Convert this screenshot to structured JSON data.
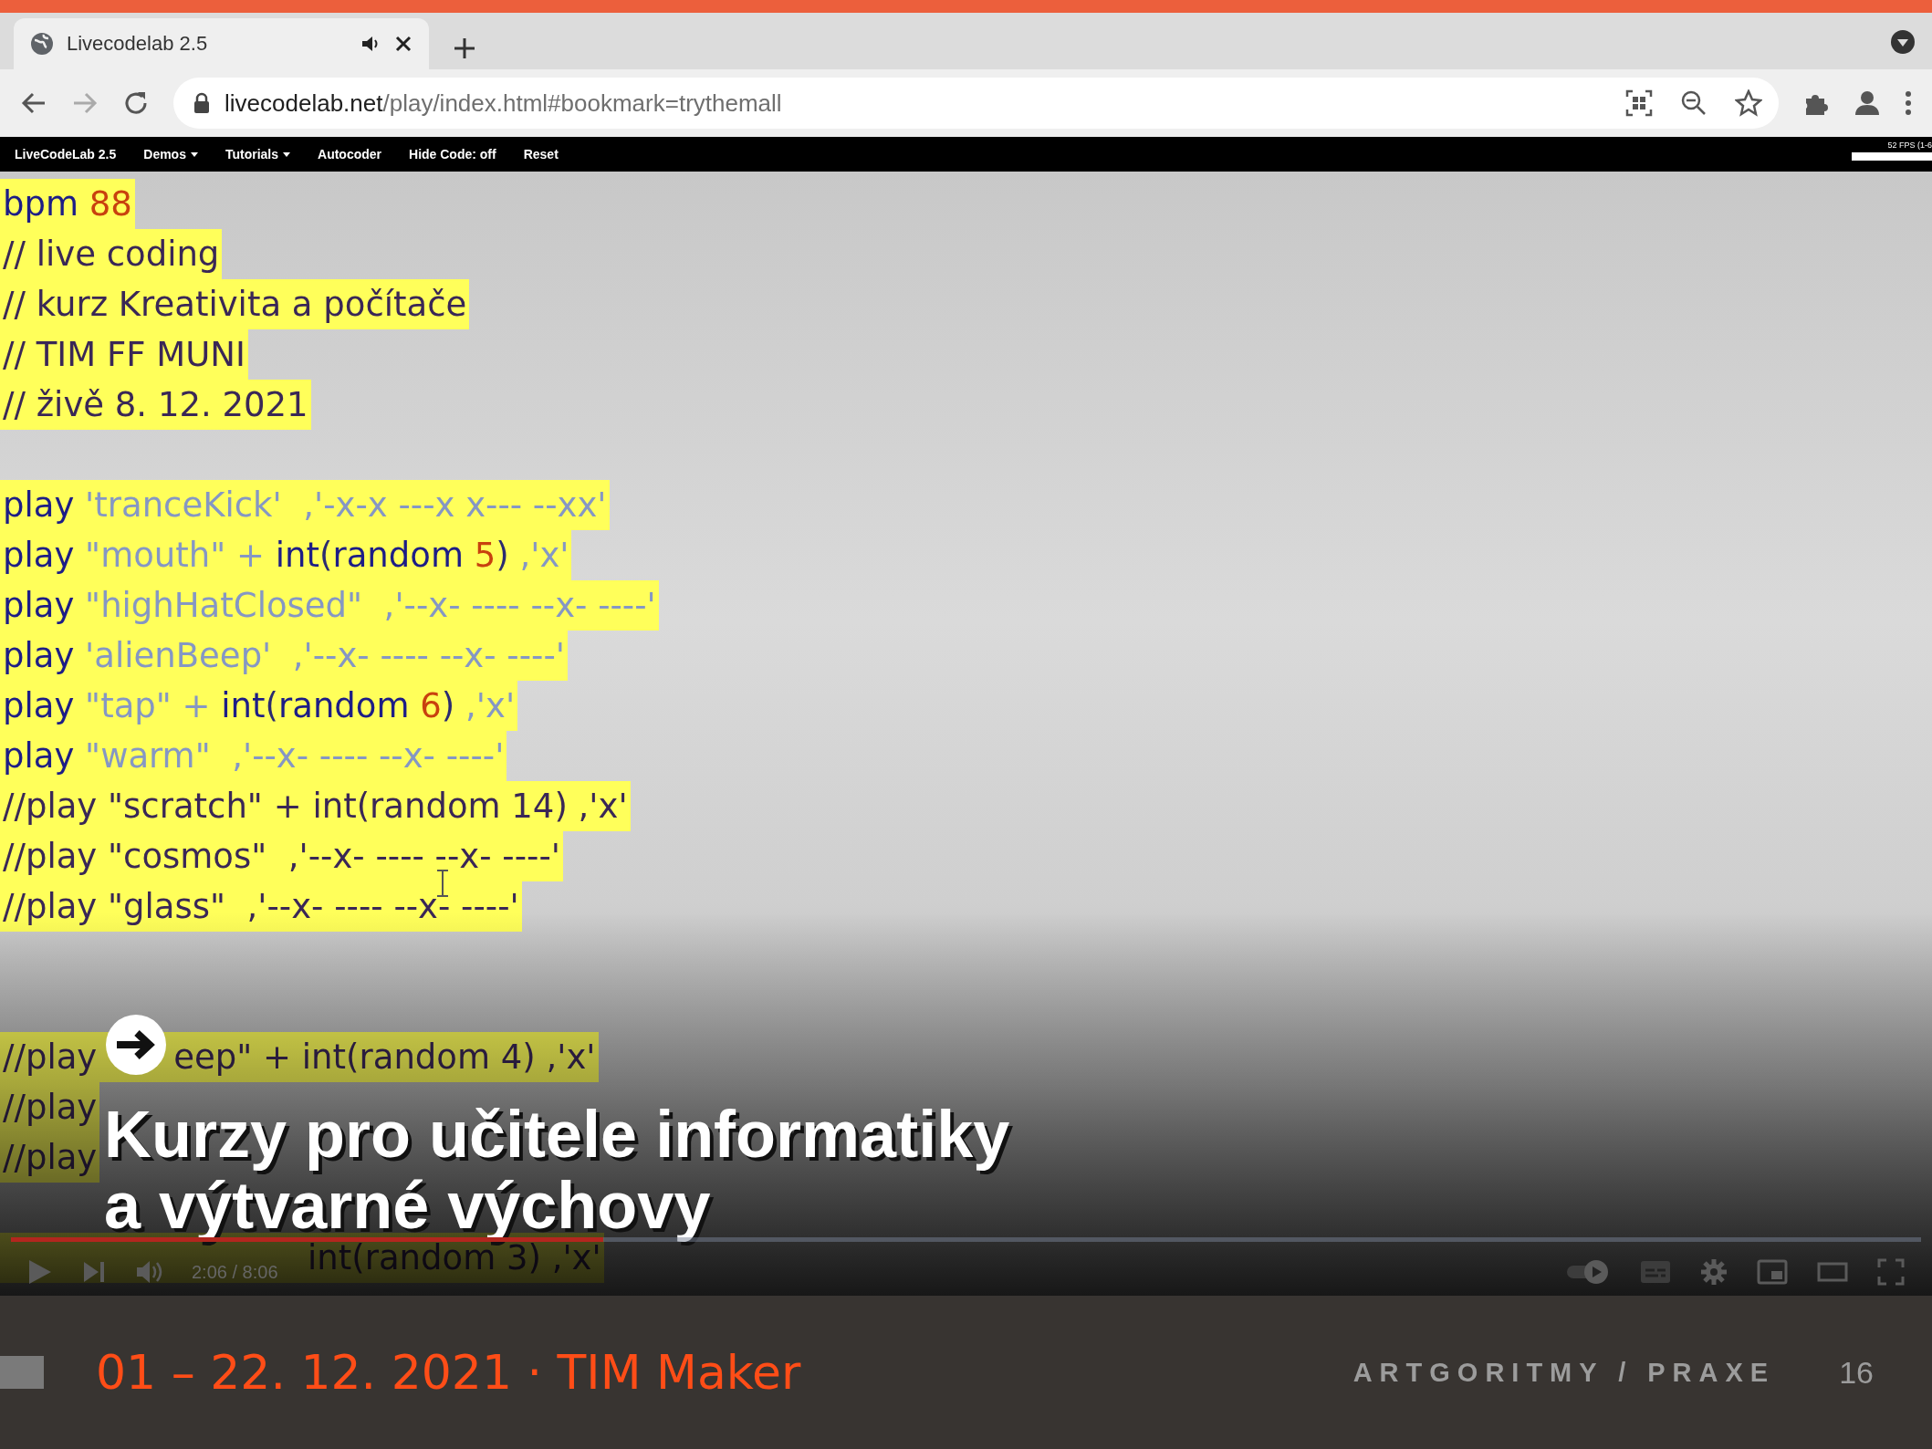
{
  "browser": {
    "tab": {
      "title": "Livecodelab 2.5",
      "audio_playing": true
    },
    "address": {
      "host": "livecodelab.net",
      "path": "/play/index.html#bookmark=trythemall"
    }
  },
  "app_menu": {
    "items": [
      {
        "label": "LiveCodeLab 2.5",
        "kind": "plain"
      },
      {
        "label": "Demos",
        "kind": "dropdown"
      },
      {
        "label": "Tutorials",
        "kind": "dropdown"
      },
      {
        "label": "Autocoder",
        "kind": "plain"
      },
      {
        "label": "Hide Code: off",
        "kind": "plain"
      },
      {
        "label": "Reset",
        "kind": "plain"
      }
    ],
    "fps": "52 FPS (1-6"
  },
  "code": [
    {
      "kind": "code",
      "tokens": [
        {
          "kind": "kw",
          "text": "bpm "
        },
        {
          "kind": "num",
          "text": "88"
        }
      ]
    },
    {
      "kind": "code",
      "tokens": [
        {
          "kind": "comment",
          "text": "// live coding"
        }
      ]
    },
    {
      "kind": "code",
      "tokens": [
        {
          "kind": "comment",
          "text": "// kurz Kreativita a počítače"
        }
      ]
    },
    {
      "kind": "code",
      "tokens": [
        {
          "kind": "comment",
          "text": "// TIM FF MUNI"
        }
      ]
    },
    {
      "kind": "code",
      "tokens": [
        {
          "kind": "comment",
          "text": "// živě 8. 12. 2021"
        }
      ]
    },
    {
      "kind": "blank"
    },
    {
      "kind": "code",
      "tokens": [
        {
          "kind": "kw",
          "text": "play "
        },
        {
          "kind": "str",
          "text": "'tranceKick'  ,'-x-x ---x x--- --xx'"
        }
      ]
    },
    {
      "kind": "code",
      "tokens": [
        {
          "kind": "kw",
          "text": "play "
        },
        {
          "kind": "str",
          "text": "\"mouth\" + "
        },
        {
          "kind": "kw",
          "text": "int"
        },
        {
          "kind": "plain",
          "text": "("
        },
        {
          "kind": "kw",
          "text": "random "
        },
        {
          "kind": "num",
          "text": "5"
        },
        {
          "kind": "plain",
          "text": ") "
        },
        {
          "kind": "str",
          "text": ",'x'"
        }
      ]
    },
    {
      "kind": "code",
      "tokens": [
        {
          "kind": "kw",
          "text": "play "
        },
        {
          "kind": "str",
          "text": "\"highHatClosed\"  ,'--x- ---- --x- ----'"
        }
      ]
    },
    {
      "kind": "code",
      "tokens": [
        {
          "kind": "kw",
          "text": "play "
        },
        {
          "kind": "str",
          "text": "'alienBeep'  ,'--x- ---- --x- ----'"
        }
      ]
    },
    {
      "kind": "code",
      "tokens": [
        {
          "kind": "kw",
          "text": "play "
        },
        {
          "kind": "str",
          "text": "\"tap\" + "
        },
        {
          "kind": "kw",
          "text": "int"
        },
        {
          "kind": "plain",
          "text": "("
        },
        {
          "kind": "kw",
          "text": "random "
        },
        {
          "kind": "num",
          "text": "6"
        },
        {
          "kind": "plain",
          "text": ") "
        },
        {
          "kind": "str",
          "text": ",'x'"
        }
      ]
    },
    {
      "kind": "code",
      "tokens": [
        {
          "kind": "kw",
          "text": "play "
        },
        {
          "kind": "str",
          "text": "\"warm\"  ,'--x- ---- --x- ----'"
        }
      ]
    },
    {
      "kind": "code",
      "tokens": [
        {
          "kind": "comment",
          "text": "//play \"scratch\" + int(random 14) ,'x'"
        }
      ]
    },
    {
      "kind": "code",
      "tokens": [
        {
          "kind": "comment",
          "text": "//play \"cosmos\"  ,'--x- ---- --x- ----'"
        }
      ]
    },
    {
      "kind": "code",
      "tokens": [
        {
          "kind": "comment",
          "text": "//play \"glass\"  ,'--x- ---- --x- ----'"
        }
      ]
    },
    {
      "kind": "blank"
    },
    {
      "kind": "blank"
    },
    {
      "kind": "code",
      "tokens": [
        {
          "kind": "comment",
          "text": "//play"
        },
        {
          "kind": "gap"
        },
        {
          "kind": "comment",
          "text": "eep\" + int(random 4) ,'x'"
        }
      ]
    },
    {
      "kind": "code",
      "tokens": [
        {
          "kind": "comment",
          "text": "//play"
        }
      ]
    },
    {
      "kind": "code",
      "tokens": [
        {
          "kind": "comment",
          "text": "//play"
        }
      ]
    },
    {
      "kind": "blank"
    },
    {
      "kind": "code",
      "tokens": [
        {
          "kind": "wide_gap"
        },
        {
          "kind": "comment",
          "text": "int(random 3) ,'x'"
        }
      ]
    }
  ],
  "video_title": [
    "Kurzy pro učitele informatiky",
    "a výtvarné výchovy"
  ],
  "player": {
    "progress": {
      "level": 0.31
    },
    "time": "2:06 / 8:06",
    "autoplay": true
  },
  "footer": {
    "date": "01 – 22. 12. 2021 · TIM Maker",
    "section": "ARTGORITMY / PRAXE",
    "page": "16"
  }
}
